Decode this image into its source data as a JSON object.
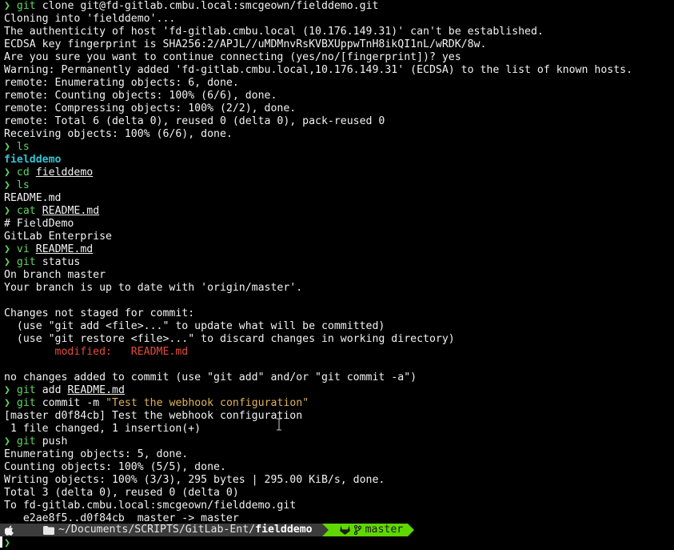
{
  "prompt_symbol": "❯",
  "lines": [
    {
      "kind": "cmd",
      "cmd": "git",
      "args": [
        {
          "t": "clone git@fd-gitlab.cmbu.local:smcgeown/fielddemo.git",
          "s": "arg"
        }
      ]
    },
    {
      "kind": "out",
      "text": "Cloning into 'fielddemo'..."
    },
    {
      "kind": "out",
      "text": "The authenticity of host 'fd-gitlab.cmbu.local (10.176.149.31)' can't be established."
    },
    {
      "kind": "out",
      "text": "ECDSA key fingerprint is SHA256:2/APJL//uMDMnvRsKVBXUppwTnH8ikQI1nL/wRDK/8w."
    },
    {
      "kind": "out",
      "text": "Are you sure you want to continue connecting (yes/no/[fingerprint])? yes"
    },
    {
      "kind": "out",
      "text": "Warning: Permanently added 'fd-gitlab.cmbu.local,10.176.149.31' (ECDSA) to the list of known hosts."
    },
    {
      "kind": "out",
      "text": "remote: Enumerating objects: 6, done."
    },
    {
      "kind": "out",
      "text": "remote: Counting objects: 100% (6/6), done."
    },
    {
      "kind": "out",
      "text": "remote: Compressing objects: 100% (2/2), done."
    },
    {
      "kind": "out",
      "text": "remote: Total 6 (delta 0), reused 0 (delta 0), pack-reused 0"
    },
    {
      "kind": "out",
      "text": "Receiving objects: 100% (6/6), done."
    },
    {
      "kind": "cmd",
      "cmd": "ls",
      "args": []
    },
    {
      "kind": "dir",
      "text": "fielddemo"
    },
    {
      "kind": "cmd",
      "cmd": "cd",
      "args": [
        {
          "t": "fielddemo",
          "s": "path"
        }
      ]
    },
    {
      "kind": "cmd",
      "cmd": "ls",
      "args": []
    },
    {
      "kind": "out",
      "text": "README.md"
    },
    {
      "kind": "cmd",
      "cmd": "cat",
      "args": [
        {
          "t": "README.md",
          "s": "path"
        }
      ]
    },
    {
      "kind": "out",
      "text": "# FieldDemo"
    },
    {
      "kind": "out",
      "text": "GitLab Enterprise"
    },
    {
      "kind": "cmd",
      "cmd": "vi",
      "args": [
        {
          "t": "README.md",
          "s": "path"
        }
      ]
    },
    {
      "kind": "cmd",
      "cmd": "git",
      "args": [
        {
          "t": "status",
          "s": "arg"
        }
      ]
    },
    {
      "kind": "out",
      "text": "On branch master"
    },
    {
      "kind": "out",
      "text": "Your branch is up to date with 'origin/master'."
    },
    {
      "kind": "out",
      "text": ""
    },
    {
      "kind": "out",
      "text": "Changes not staged for commit:"
    },
    {
      "kind": "out",
      "text": "  (use \"git add <file>...\" to update what will be committed)"
    },
    {
      "kind": "out",
      "text": "  (use \"git restore <file>...\" to discard changes in working directory)"
    },
    {
      "kind": "mod",
      "text": "\tmodified:   README.md"
    },
    {
      "kind": "out",
      "text": ""
    },
    {
      "kind": "out",
      "text": "no changes added to commit (use \"git add\" and/or \"git commit -a\")"
    },
    {
      "kind": "cmd",
      "cmd": "git",
      "args": [
        {
          "t": "add",
          "s": "arg"
        },
        {
          "t": "README.md",
          "s": "path"
        }
      ]
    },
    {
      "kind": "cmd",
      "cmd": "git",
      "args": [
        {
          "t": "commit -m",
          "s": "arg"
        },
        {
          "t": "\"Test the webhook configuration\"",
          "s": "str"
        }
      ]
    },
    {
      "kind": "out",
      "text": "[master d0f84cb] Test the webhook configuration"
    },
    {
      "kind": "out",
      "text": " 1 file changed, 1 insertion(+)"
    },
    {
      "kind": "cmd",
      "cmd": "git",
      "args": [
        {
          "t": "push",
          "s": "arg"
        }
      ]
    },
    {
      "kind": "out",
      "text": "Enumerating objects: 5, done."
    },
    {
      "kind": "out",
      "text": "Counting objects: 100% (5/5), done."
    },
    {
      "kind": "out",
      "text": "Writing objects: 100% (3/3), 295 bytes | 295.00 KiB/s, done."
    },
    {
      "kind": "out",
      "text": "Total 3 (delta 0), reused 0 (delta 0)"
    },
    {
      "kind": "out",
      "text": "To fd-gitlab.cmbu.local:smcgeown/fielddemo.git"
    },
    {
      "kind": "out",
      "text": "   e2ae8f5..d0f84cb  master -> master"
    }
  ],
  "statusbar": {
    "os_icon": "apple-icon",
    "folder_icon": "folder-icon",
    "path_prefix": "~/Documents/SCRIPTS/GitLab-Ent/",
    "path_last": "fielddemo",
    "git_icon": "gitlab-icon",
    "branch_icon": "branch-icon",
    "branch": "master",
    "colors": {
      "segment_bg": "#3c3c3c",
      "git_bg": "#5fd700",
      "prompt": "#5fd75f",
      "directory": "#35c3d3",
      "modified": "#e24b3b",
      "string": "#e0b35a"
    }
  }
}
